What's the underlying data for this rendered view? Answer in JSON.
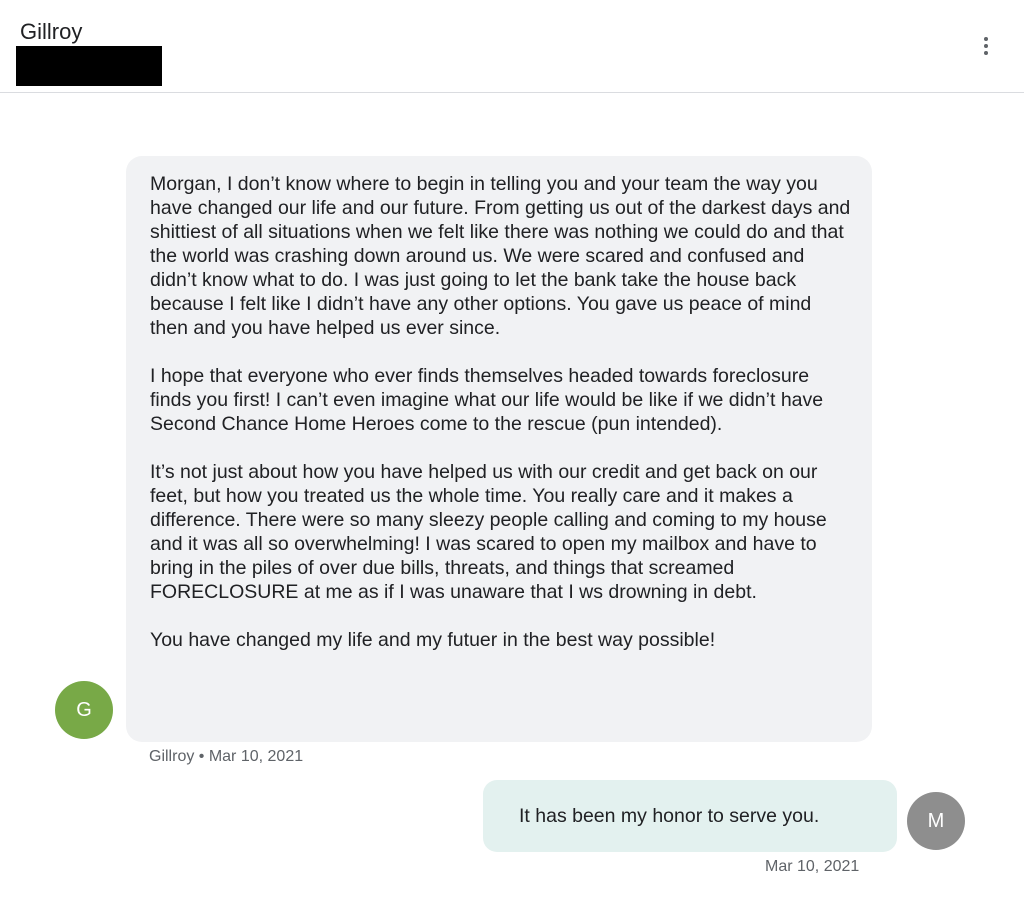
{
  "header": {
    "contact_name": "Gillroy",
    "menu_icon": "more-vert-icon"
  },
  "messages": [
    {
      "direction": "incoming",
      "avatar_initial": "G",
      "avatar_color": "#78a947",
      "paragraphs": [
        "Morgan, I don’t know where to begin in telling you and your team the way you have changed our life and our future. From getting us out of the darkest days and shittiest of all situations when we felt like there was nothing we could do and that the world was crashing down around us. We were scared and confused and didn’t know what to do. I was just going to let the bank take the house back because I felt like I didn’t have any other options. You gave us peace of mind then and you have helped us ever since.",
        "I hope that everyone who ever finds themselves headed towards foreclosure finds you first! I can’t even imagine what our life would be like if we didn’t have Second Chance Home Heroes come to the rescue (pun intended).",
        "It’s not just about how you have helped us with our credit and get back on our feet, but how you treated us the whole time. You really care and it makes a difference. There were so many sleezy people calling and coming to my house and it was all so overwhelming! I was scared to open my mailbox and have to bring in the piles of over due bills, threats, and things that screamed FORECLOSURE at me as if I was unaware that I ws drowning in debt.",
        "You have changed my life and my futuer in the best way possible!"
      ],
      "meta": "Gillroy • Mar 10, 2021",
      "bubble_color": "#f1f2f4"
    },
    {
      "direction": "outgoing",
      "avatar_initial": "M",
      "avatar_color": "#8e8e8e",
      "text": "It has been my honor to serve you.",
      "meta": "Mar 10, 2021",
      "bubble_color": "#e3f1ef"
    }
  ]
}
